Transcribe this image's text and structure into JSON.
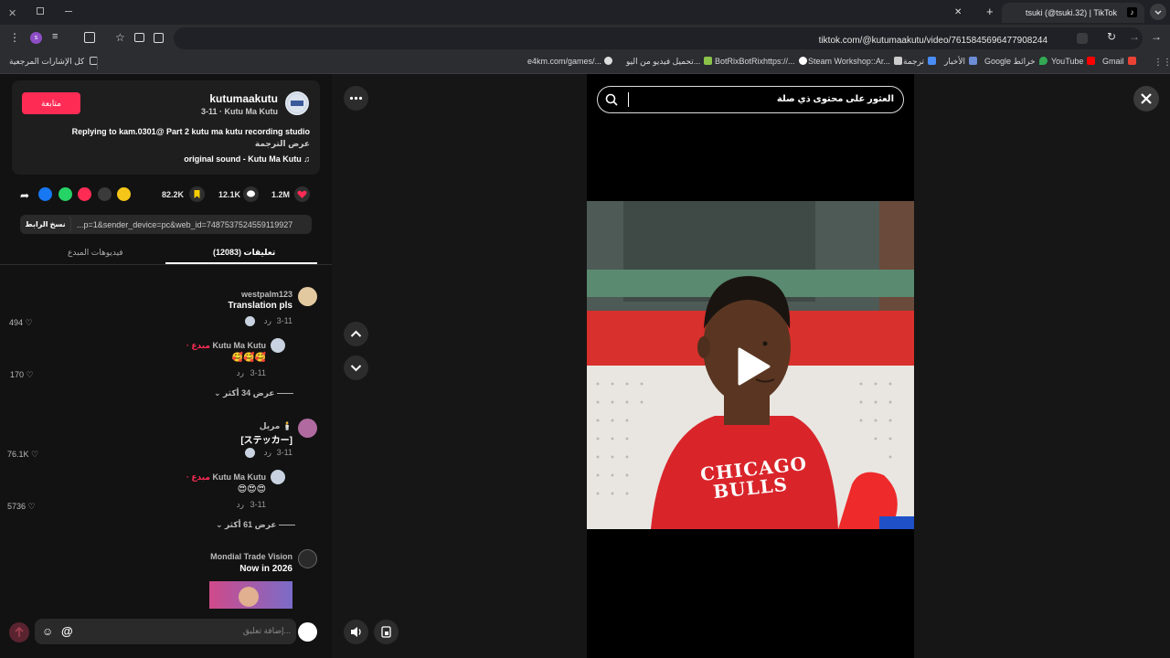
{
  "browser": {
    "tab_title": "tsuki (@tsuki.32) | TikTok",
    "url": "tiktok.com/@kutumaakutu/video/7615845696477908244",
    "bookmarks": [
      {
        "label": "كل الإشارات المرجعية"
      },
      {
        "label": "e4km.com/games/..."
      },
      {
        "label": "تحميل فيديو من اليو..."
      },
      {
        "label": "BotRixBotRixhttps://..."
      },
      {
        "label": "Steam Workshop::Ar..."
      },
      {
        "label": "ترجمة"
      },
      {
        "label": "الأخبار"
      },
      {
        "label": "Google خرائط"
      },
      {
        "label": "YouTube"
      },
      {
        "label": "Gmail"
      }
    ]
  },
  "post": {
    "username": "kutumaakutu",
    "subline": "3-11 · Kutu Ma Kutu",
    "follow_label": "متابعة",
    "caption": "Replying to kam.0301@ Part 2 kutu ma kutu recording studio",
    "see_translation": "عرض الترجمة",
    "sound": "original sound - Kutu Ma Kutu",
    "likes": "1.2M",
    "comments": "12.1K",
    "saves": "82.2K",
    "link": "...p=1&sender_device=pc&web_id=7487537524559119927",
    "copy_link_label": "نسخ الرابط"
  },
  "tabs": {
    "comments": "تعليقات (12083)",
    "creator_videos": "فيديوهات المبدع"
  },
  "comments": [
    {
      "user": "westpalm123",
      "text": "Translation pls",
      "date": "3-11",
      "reply": "رد",
      "likes": "494"
    },
    {
      "user": "Kutu Ma Kutu",
      "creator": "· مبدع",
      "text": "🥰🥰🥰",
      "date": "3-11",
      "reply": "رد",
      "likes": "170"
    },
    {
      "more": "عرض 34 أكثر"
    },
    {
      "user": "مريل 🕯️",
      "text": "[ステッカー]",
      "date": "3-11",
      "reply": "رد",
      "likes": "76.1K"
    },
    {
      "user": "Kutu Ma Kutu",
      "creator": "· مبدع",
      "text": "😍😍😍",
      "date": "3-11",
      "reply": "رد",
      "likes": "5736"
    },
    {
      "more": "عرض 61 أكثر"
    },
    {
      "user": "Mondial Trade Vision",
      "text": "Now in 2026"
    }
  ],
  "composer": {
    "placeholder": "إضافة تعليق..."
  },
  "video": {
    "search_placeholder": "العثور على محتوى ذي صلة",
    "shirt_text_1": "CHICAGO",
    "shirt_text_2": "BULLS"
  },
  "colors": {
    "accent": "#fe2c55",
    "panel_bg": "#121212",
    "card_bg": "#1e1e1e"
  }
}
